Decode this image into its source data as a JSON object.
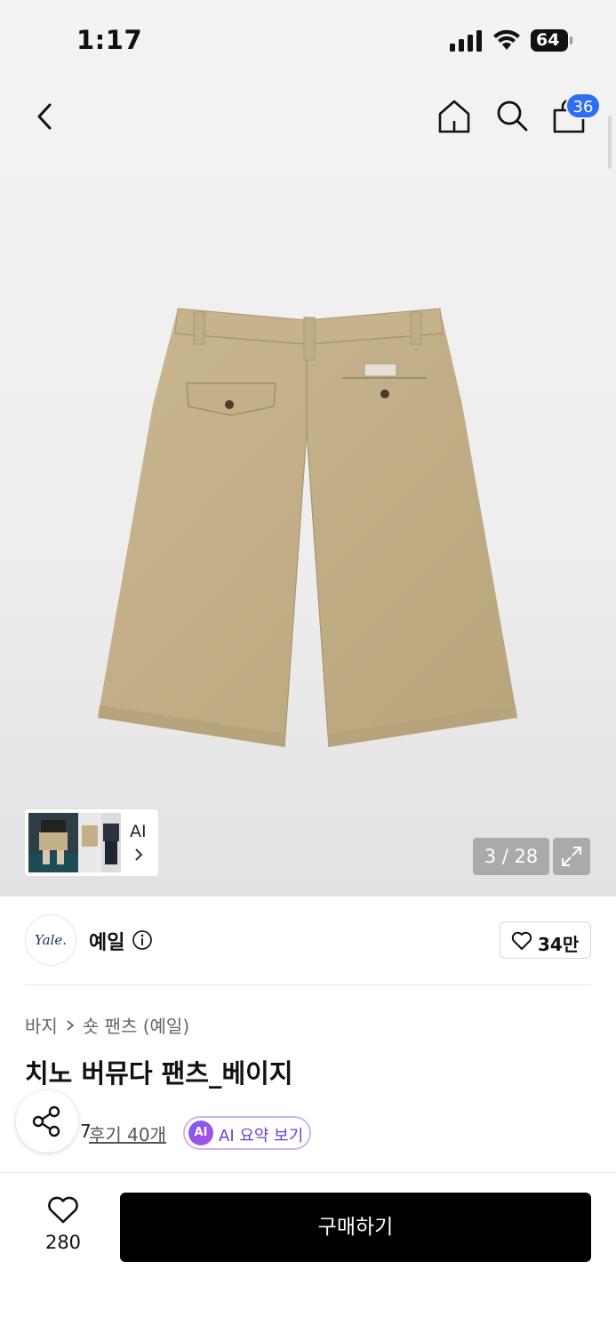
{
  "status_bar": {
    "time": "1:17",
    "battery": "64"
  },
  "header": {
    "cart_count": "36"
  },
  "gallery": {
    "counter": "3 / 28",
    "thumb_label": "AI",
    "product_color": "#c4b088"
  },
  "brand": {
    "logo_text": "Yale.",
    "name": "예일",
    "likes": "34만"
  },
  "breadcrumb": {
    "category": "바지",
    "subcategory": "숏 팬츠 (예일)"
  },
  "product": {
    "title": "치노 버뮤다 팬츠_베이지",
    "rating": "7",
    "review_link": "후기 40개",
    "ai_badge": "AI",
    "ai_summary": "AI 요약 보기"
  },
  "bottom": {
    "like_count": "280",
    "buy_label": "구매하기"
  },
  "colors": {
    "accent_blue": "#2f6df2",
    "ai_purple": "#6c3fd6",
    "buy_black": "#000000"
  }
}
